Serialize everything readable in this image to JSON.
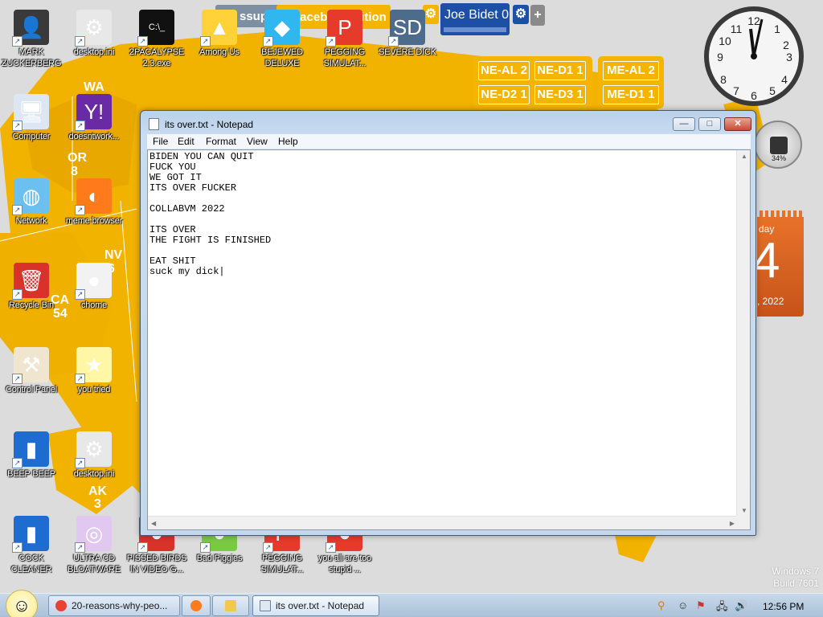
{
  "desktop": {
    "icons": [
      {
        "id": "mark",
        "label": "MARK ZUCKERBERG",
        "glyph": "👤",
        "bg": "#3a3a3a"
      },
      {
        "id": "desktop-ini-1",
        "label": "desktop.ini",
        "glyph": "⚙",
        "bg": "#e8e8e8"
      },
      {
        "id": "2pac",
        "label": "2PACALYPSE 2.3.exe",
        "glyph": "C:\\_",
        "bg": "#111111"
      },
      {
        "id": "among",
        "label": "Among Us",
        "glyph": "▲",
        "bg": "#ffd23a"
      },
      {
        "id": "bejeweled",
        "label": "BEJEWED DELUXE",
        "glyph": "◆",
        "bg": "#30b7f0"
      },
      {
        "id": "pegging1",
        "label": "PEGGING SIMULAT...",
        "glyph": "P",
        "bg": "#e63a2a"
      },
      {
        "id": "severe",
        "label": "SEVERE DICK",
        "glyph": "SD",
        "bg": "#4d6b8a"
      },
      {
        "id": "computer",
        "label": "Computer",
        "glyph": "🖥",
        "bg": "#dce7f3"
      },
      {
        "id": "doesntwork",
        "label": "doesntwork...",
        "glyph": "Y!",
        "bg": "#6a2aa5"
      },
      {
        "id": "network",
        "label": "Network",
        "glyph": "◍",
        "bg": "#6cc0f0"
      },
      {
        "id": "meme",
        "label": "meme browser",
        "glyph": "◐",
        "bg": "#ff7a1a"
      },
      {
        "id": "recycle",
        "label": "Recycle Bin",
        "glyph": "🗑",
        "bg": "#d8322a"
      },
      {
        "id": "chome",
        "label": "chome",
        "glyph": "●",
        "bg": "#f2f2f2"
      },
      {
        "id": "control",
        "label": "Control Panel",
        "glyph": "⚒",
        "bg": "#f0e6d0"
      },
      {
        "id": "youtried",
        "label": "you tried",
        "glyph": "★",
        "bg": "#fff6a6"
      },
      {
        "id": "beep",
        "label": "BEEP BEEP",
        "glyph": "▮",
        "bg": "#1e6cd0"
      },
      {
        "id": "desktop-ini-2",
        "label": "desktop.ini",
        "glyph": "⚙",
        "bg": "#e8e8e8"
      },
      {
        "id": "cock",
        "label": "COCK CLEANER",
        "glyph": "▮",
        "bg": "#1e6cd0"
      },
      {
        "id": "ultra",
        "label": "ULTRA CD BLOATWARE",
        "glyph": "◎",
        "bg": "#e0c8f0"
      },
      {
        "id": "pissed",
        "label": "PISSED BIRDS IN VIDEO G...",
        "glyph": "●",
        "bg": "#d8322a"
      },
      {
        "id": "piggies",
        "label": "Bad Piggies",
        "glyph": "●",
        "bg": "#7ac943"
      },
      {
        "id": "pegging2",
        "label": "PEGGING SIMULAT...",
        "glyph": "P",
        "bg": "#e63a2a"
      },
      {
        "id": "toostupid",
        "label": "you all are too stupid ...",
        "glyph": "●",
        "bg": "#e63a2a"
      }
    ],
    "map_labels": [
      "WA",
      "OR",
      "8",
      "NV",
      "6",
      "CA",
      "54",
      "AK",
      "3"
    ],
    "scoreboard": {
      "left_label": "ssup 0",
      "mid_label": "Faceb",
      "mid_suffix": "dition",
      "right_label": "Joe Bidet 0",
      "plus": "+"
    },
    "votes": {
      "left": [
        "NE-AL 2",
        "NE-D1 1",
        "NE-D2 1",
        "NE-D3 1"
      ],
      "right": [
        "ME-AL 2",
        "ME-D1 1"
      ]
    },
    "cpu_gadget": {
      "percent": "34%"
    },
    "calendar": {
      "day_fragment": "day",
      "date": "4",
      "year": ", 2022"
    },
    "watermark": {
      "line1": "Windows 7",
      "line2": "Build 7601"
    }
  },
  "notepad": {
    "title": "its over.txt - Notepad",
    "menu": [
      "File",
      "Edit",
      "Format",
      "View",
      "Help"
    ],
    "content": "BIDEN YOU CAN QUIT\nFUCK YOU\nWE GOT IT\nITS OVER FUCKER\n\nCOLLABVM 2022\n\nITS OVER\nTHE FIGHT IS FINISHED\n\nEAT SHIT\nsuck my dick|",
    "buttons": {
      "minimize": "—",
      "maximize": "□",
      "close": "✕"
    }
  },
  "taskbar": {
    "tasks": [
      {
        "label": "20-reasons-why-peo...",
        "color": "#e94235"
      },
      {
        "label": "",
        "color": "#ff7a1a"
      },
      {
        "label": "",
        "color": "#f2c94c"
      },
      {
        "label": "its over.txt - Notepad",
        "color": "#dfe8f2"
      }
    ],
    "time": "12:56 PM"
  }
}
